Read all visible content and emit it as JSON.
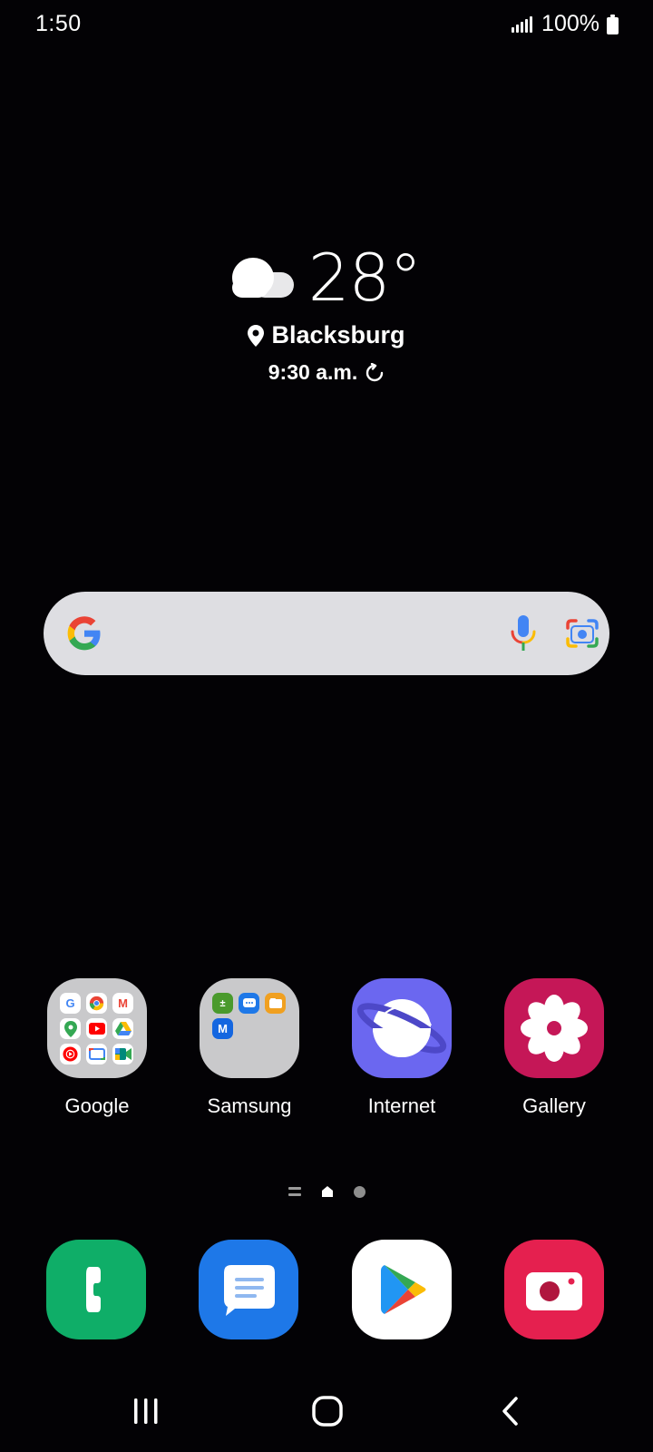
{
  "status_bar": {
    "time": "1:50",
    "battery_text": "100%"
  },
  "weather": {
    "temperature": "28°",
    "location": "Blacksburg",
    "updated_time": "9:30 a.m."
  },
  "apps": [
    {
      "label": "Google"
    },
    {
      "label": "Samsung"
    },
    {
      "label": "Internet"
    },
    {
      "label": "Gallery"
    }
  ],
  "colors": {
    "background": "#030205",
    "search_bar": "#dedee2",
    "internet": "#6b67f0",
    "gallery": "#c51757",
    "phone": "#0fae68",
    "messages": "#1e78e8",
    "camera": "#e5204f"
  },
  "icons": [
    "cloud-icon",
    "location-pin-icon",
    "refresh-icon",
    "google-g-icon",
    "mic-icon",
    "google-lens-icon",
    "phone-icon",
    "messages-icon",
    "play-store-icon",
    "camera-icon",
    "recents-icon",
    "home-icon",
    "back-icon"
  ]
}
